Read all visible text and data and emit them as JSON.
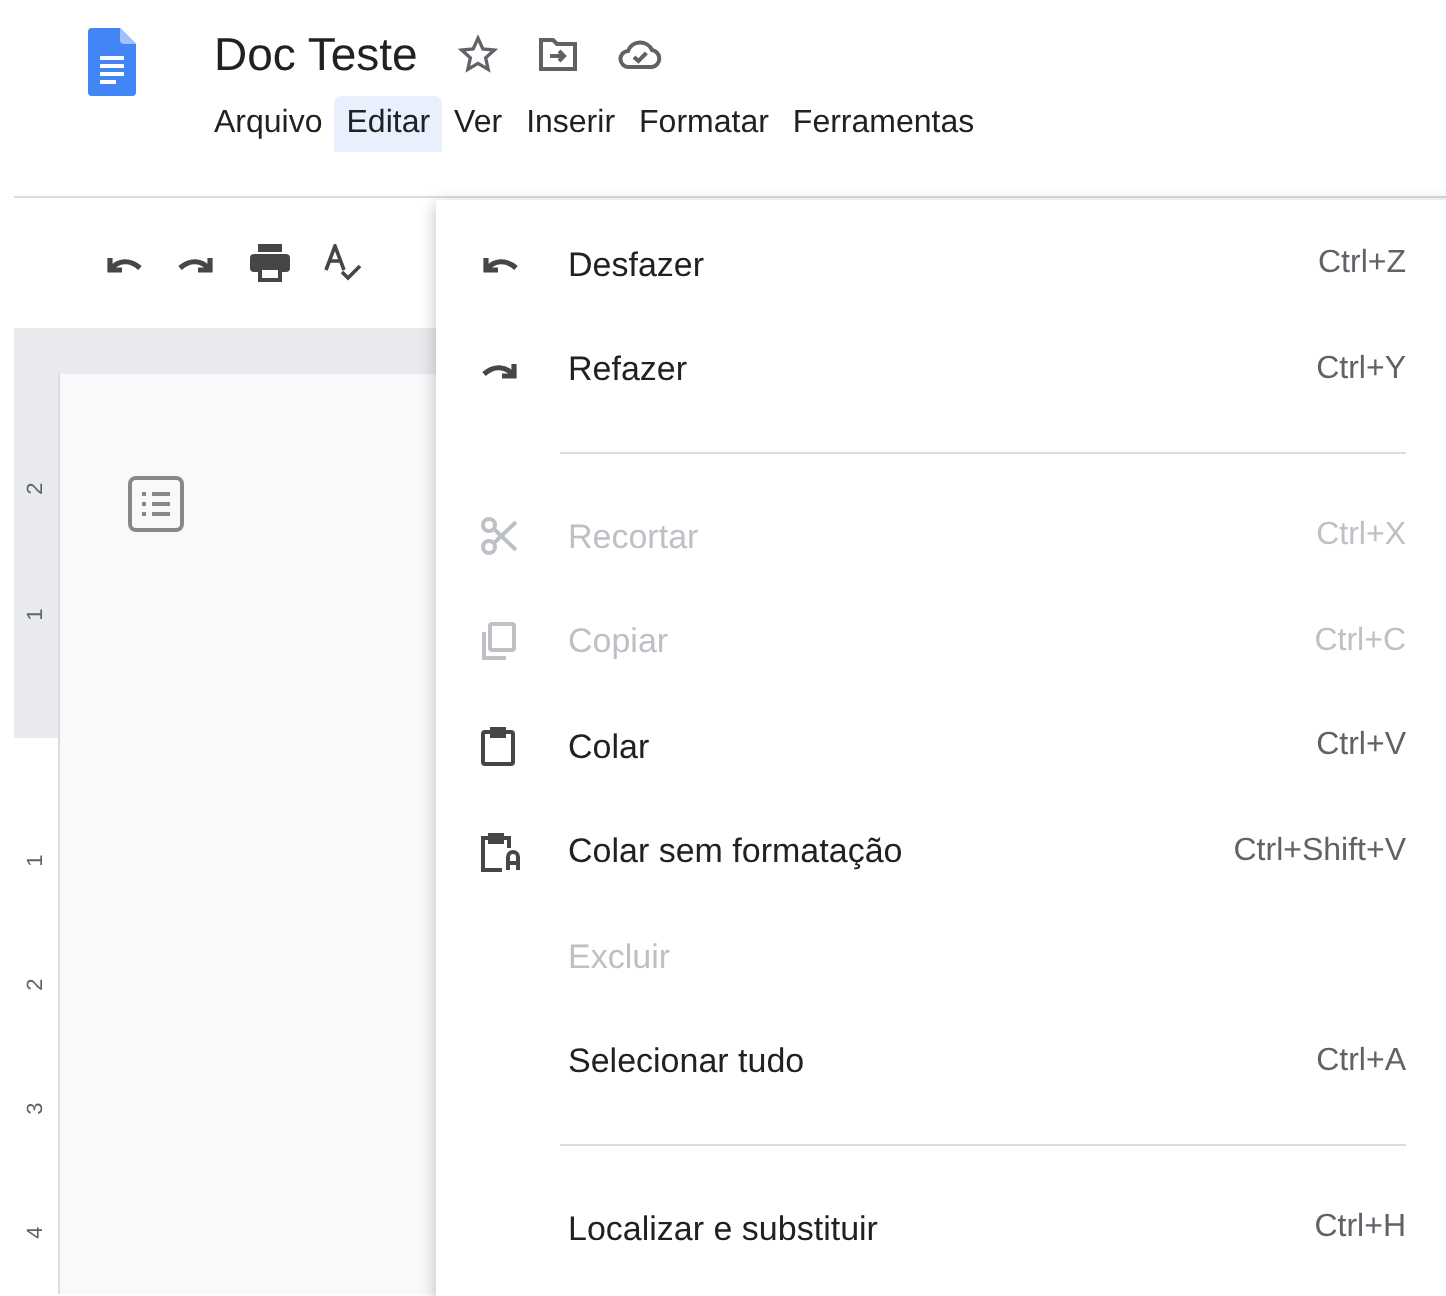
{
  "document": {
    "title": "Doc Teste"
  },
  "menu_bar": [
    {
      "label": "Arquivo",
      "selected": false
    },
    {
      "label": "Editar",
      "selected": true
    },
    {
      "label": "Ver",
      "selected": false
    },
    {
      "label": "Inserir",
      "selected": false
    },
    {
      "label": "Formatar",
      "selected": false
    },
    {
      "label": "Ferramentas",
      "selected": false
    }
  ],
  "vertical_ruler": {
    "upper_labels": [
      "2",
      "1"
    ],
    "lower_labels": [
      "1",
      "2",
      "3",
      "4"
    ]
  },
  "edit_menu": [
    {
      "kind": "item",
      "label": "Desfazer",
      "shortcut": "Ctrl+Z",
      "disabled": false
    },
    {
      "kind": "item",
      "label": "Refazer",
      "shortcut": "Ctrl+Y",
      "disabled": false
    },
    {
      "kind": "separator"
    },
    {
      "kind": "item",
      "label": "Recortar",
      "shortcut": "Ctrl+X",
      "disabled": true
    },
    {
      "kind": "item",
      "label": "Copiar",
      "shortcut": "Ctrl+C",
      "disabled": true
    },
    {
      "kind": "item",
      "label": "Colar",
      "shortcut": "Ctrl+V",
      "disabled": false
    },
    {
      "kind": "item",
      "label": "Colar sem formatação",
      "shortcut": "Ctrl+Shift+V",
      "disabled": false
    },
    {
      "kind": "item",
      "label": "Excluir",
      "disabled": true
    },
    {
      "kind": "item",
      "label": "Selecionar tudo",
      "shortcut": "Ctrl+A",
      "disabled": false
    },
    {
      "kind": "separator"
    },
    {
      "kind": "item",
      "label": "Localizar e substituir",
      "shortcut": "Ctrl+H",
      "disabled": false
    }
  ]
}
